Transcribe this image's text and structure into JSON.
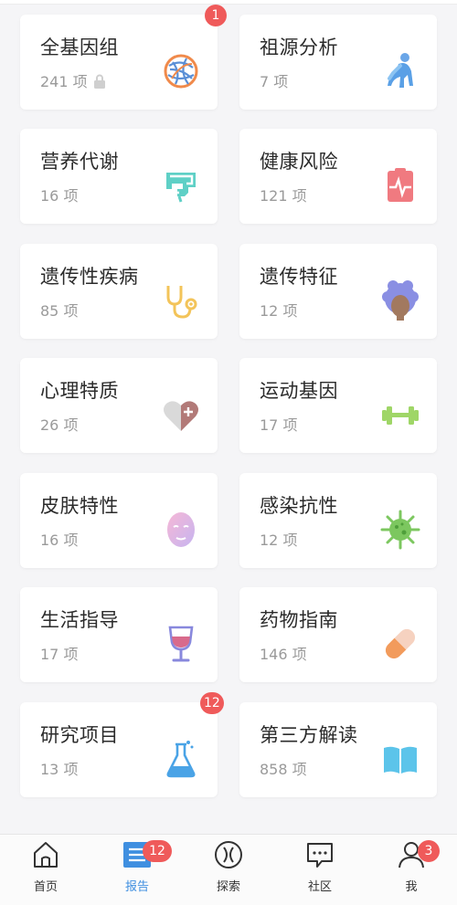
{
  "cards": [
    {
      "title": "全基因组",
      "count": "241 项",
      "icon": "dna-network-icon",
      "badge": "1",
      "locked": true
    },
    {
      "title": "祖源分析",
      "count": "7 项",
      "icon": "evolution-human-icon"
    },
    {
      "title": "营养代谢",
      "count": "16 项",
      "icon": "stomach-icon"
    },
    {
      "title": "健康风险",
      "count": "121 项",
      "icon": "heartbeat-clipboard-icon"
    },
    {
      "title": "遗传性疾病",
      "count": "85 项",
      "icon": "stethoscope-icon"
    },
    {
      "title": "遗传特征",
      "count": "12 项",
      "icon": "curly-hair-head-icon"
    },
    {
      "title": "心理特质",
      "count": "26 项",
      "icon": "heart-plus-icon"
    },
    {
      "title": "运动基因",
      "count": "17 项",
      "icon": "dumbbell-icon"
    },
    {
      "title": "皮肤特性",
      "count": "16 项",
      "icon": "face-mask-icon"
    },
    {
      "title": "感染抗性",
      "count": "12 项",
      "icon": "virus-icon"
    },
    {
      "title": "生活指导",
      "count": "17 项",
      "icon": "wine-glass-icon"
    },
    {
      "title": "药物指南",
      "count": "146 项",
      "icon": "pill-capsule-icon"
    },
    {
      "title": "研究项目",
      "count": "13 项",
      "icon": "flask-icon",
      "badge": "12"
    },
    {
      "title": "第三方解读",
      "count": "858 项",
      "icon": "book-icon"
    }
  ],
  "tabbar": {
    "tabs": [
      {
        "label": "首页",
        "icon": "home-icon"
      },
      {
        "label": "报告",
        "icon": "report-list-icon",
        "badge": "12",
        "active": true
      },
      {
        "label": "探索",
        "icon": "explore-compass-icon"
      },
      {
        "label": "社区",
        "icon": "chat-bubble-icon"
      },
      {
        "label": "我",
        "icon": "user-icon",
        "badge": "3"
      }
    ]
  },
  "colors": {
    "accent": "#3f8fe0",
    "badge": "#ef5a5a",
    "text": "#2b2b2b",
    "subtext": "#9a9a9a"
  }
}
